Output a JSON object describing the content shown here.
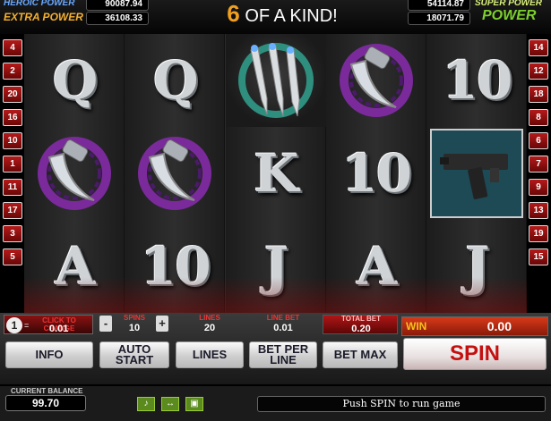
{
  "header": {
    "headline_num": "6",
    "headline_text": "OF A KIND!",
    "jackpots": {
      "left_top_label": "HEROIC POWER",
      "left_top_value": "90087.94",
      "left_bottom_label": "EXTRA POWER",
      "left_bottom_value": "36108.33",
      "right_top_value": "54114.87",
      "right_top_label": "SUPER POWER",
      "right_bottom_value": "18071.79",
      "right_bottom_label": "POWER"
    }
  },
  "paylines": {
    "left": [
      "4",
      "2",
      "20",
      "16",
      "10",
      "1",
      "11",
      "17",
      "3",
      "5"
    ],
    "right": [
      "14",
      "12",
      "18",
      "8",
      "6",
      "7",
      "9",
      "13",
      "19",
      "15"
    ]
  },
  "reels": [
    [
      "Q",
      "blade-ring",
      "A"
    ],
    [
      "Q",
      "blade-ring",
      "10"
    ],
    [
      "darts",
      "K",
      "J"
    ],
    [
      "blade-ring",
      "10",
      "A"
    ],
    [
      "10",
      "pistol",
      "J"
    ]
  ],
  "controls": {
    "coin_value_label": "CLICK TO CHANGE",
    "coin_number": "1",
    "coin_equals": "=",
    "coin_value": "0.01",
    "spins_label": "SPINS",
    "spins_value": "10",
    "minus": "-",
    "plus": "+",
    "lines_label": "LINES",
    "lines_value": "20",
    "line_bet_label": "LINE BET",
    "line_bet_value": "0.01",
    "total_bet_label": "TOTAL BET",
    "total_bet_value": "0.20",
    "win_label": "WIN",
    "win_value": "0.00",
    "info_label": "INFO",
    "auto_start_label_1": "AUTO",
    "auto_start_label_2": "START",
    "lines_btn_label": "LINES",
    "bet_per_line_1": "BET PER",
    "bet_per_line_2": "LINE",
    "bet_max_label": "BET MAX",
    "spin_label": "SPIN"
  },
  "status": {
    "balance_label": "CURRENT BALANCE",
    "balance_value": "99.70",
    "message": "Push SPIN to run game"
  }
}
